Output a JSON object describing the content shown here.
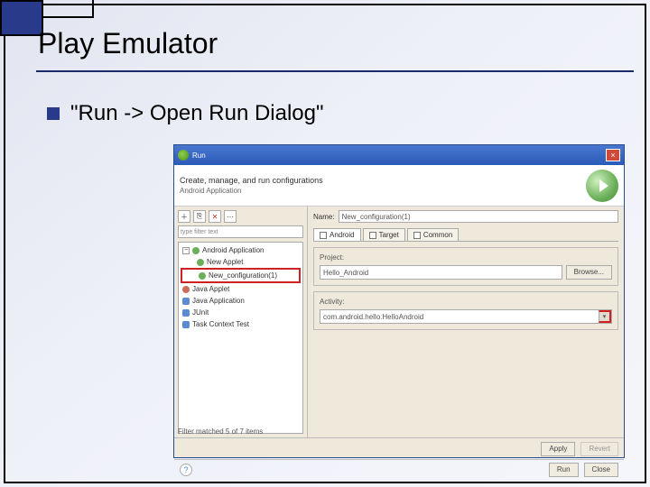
{
  "slide": {
    "title": "Play Emulator",
    "bullet": "\"Run -> Open Run Dialog\""
  },
  "dialog": {
    "title": "Run",
    "header": "Create, manage, and run configurations",
    "subheader": "Android Application",
    "filter_placeholder": "type filter text",
    "tree": {
      "android_app": "Android Application",
      "new_applet": "New Applet",
      "new_config": "New_configuration(1)",
      "java_applet": "Java Applet",
      "java_app": "Java Application",
      "junit": "JUnit",
      "task_context": "Task Context Test"
    },
    "filter_status": "Filter matched 5 of 7 items",
    "name_label": "Name:",
    "name_value": "New_configuration(1)",
    "tabs": {
      "android": "Android",
      "target": "Target",
      "common": "Common"
    },
    "project_label": "Project:",
    "project_value": "Hello_Android",
    "browse_btn": "Browse...",
    "activity_label": "Activity:",
    "activity_value": "com.android.hello.HelloAndroid",
    "apply_btn": "Apply",
    "revert_btn": "Revert",
    "run_btn": "Run",
    "close_btn": "Close"
  }
}
